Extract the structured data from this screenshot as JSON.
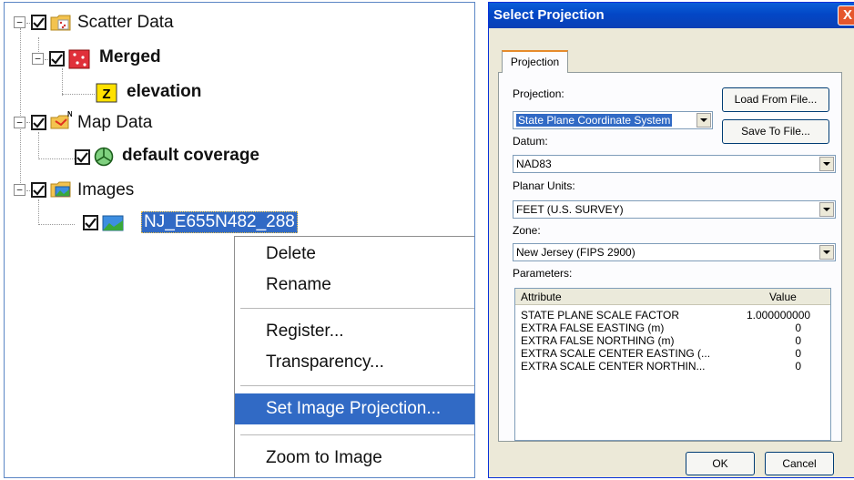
{
  "tree": {
    "scatter_data": {
      "label": "Scatter Data",
      "icon": "scatter-folder-icon",
      "checked": true
    },
    "merged": {
      "label": "Merged",
      "icon": "scatter-set-icon",
      "checked": true
    },
    "elevation": {
      "label": "elevation",
      "icon": "z-dataset-icon"
    },
    "map_data": {
      "label": "Map Data",
      "icon": "map-folder-icon",
      "checked": true
    },
    "default_coverage": {
      "label": "default coverage",
      "icon": "coverage-icon",
      "checked": true
    },
    "images": {
      "label": "Images",
      "icon": "images-folder-icon",
      "checked": true
    },
    "image_item": {
      "label": "NJ_E655N482_288",
      "icon": "image-icon",
      "checked": true
    }
  },
  "context_menu": {
    "delete": "Delete",
    "rename": "Rename",
    "register": "Register...",
    "transparency": "Transparency...",
    "set_projection": "Set Image Projection...",
    "zoom": "Zoom to Image"
  },
  "dialog": {
    "title": "Select Projection",
    "close": "X",
    "tab": "Projection",
    "projection_label": "Projection:",
    "projection_value": "State Plane Coordinate System",
    "load_button": "Load From File...",
    "save_button": "Save To File...",
    "datum_label": "Datum:",
    "datum_value": "NAD83",
    "units_label": "Planar Units:",
    "units_value": "FEET (U.S. SURVEY)",
    "zone_label": "Zone:",
    "zone_value": "New Jersey (FIPS 2900)",
    "params_label": "Parameters:",
    "columns": {
      "attribute": "Attribute",
      "value": "Value"
    },
    "parameters": [
      {
        "attribute": "STATE PLANE SCALE FACTOR",
        "value": "1.000000000"
      },
      {
        "attribute": "EXTRA FALSE EASTING (m)",
        "value": "0"
      },
      {
        "attribute": "EXTRA FALSE NORTHING (m)",
        "value": "0"
      },
      {
        "attribute": "EXTRA SCALE CENTER EASTING (...",
        "value": "0"
      },
      {
        "attribute": "EXTRA SCALE CENTER NORTHIN...",
        "value": "0"
      }
    ],
    "ok_button": "OK",
    "cancel_button": "Cancel"
  },
  "colors": {
    "selection": "#316ac5",
    "titlebar": "#0347c6",
    "dialog_bg": "#ece9d8"
  }
}
